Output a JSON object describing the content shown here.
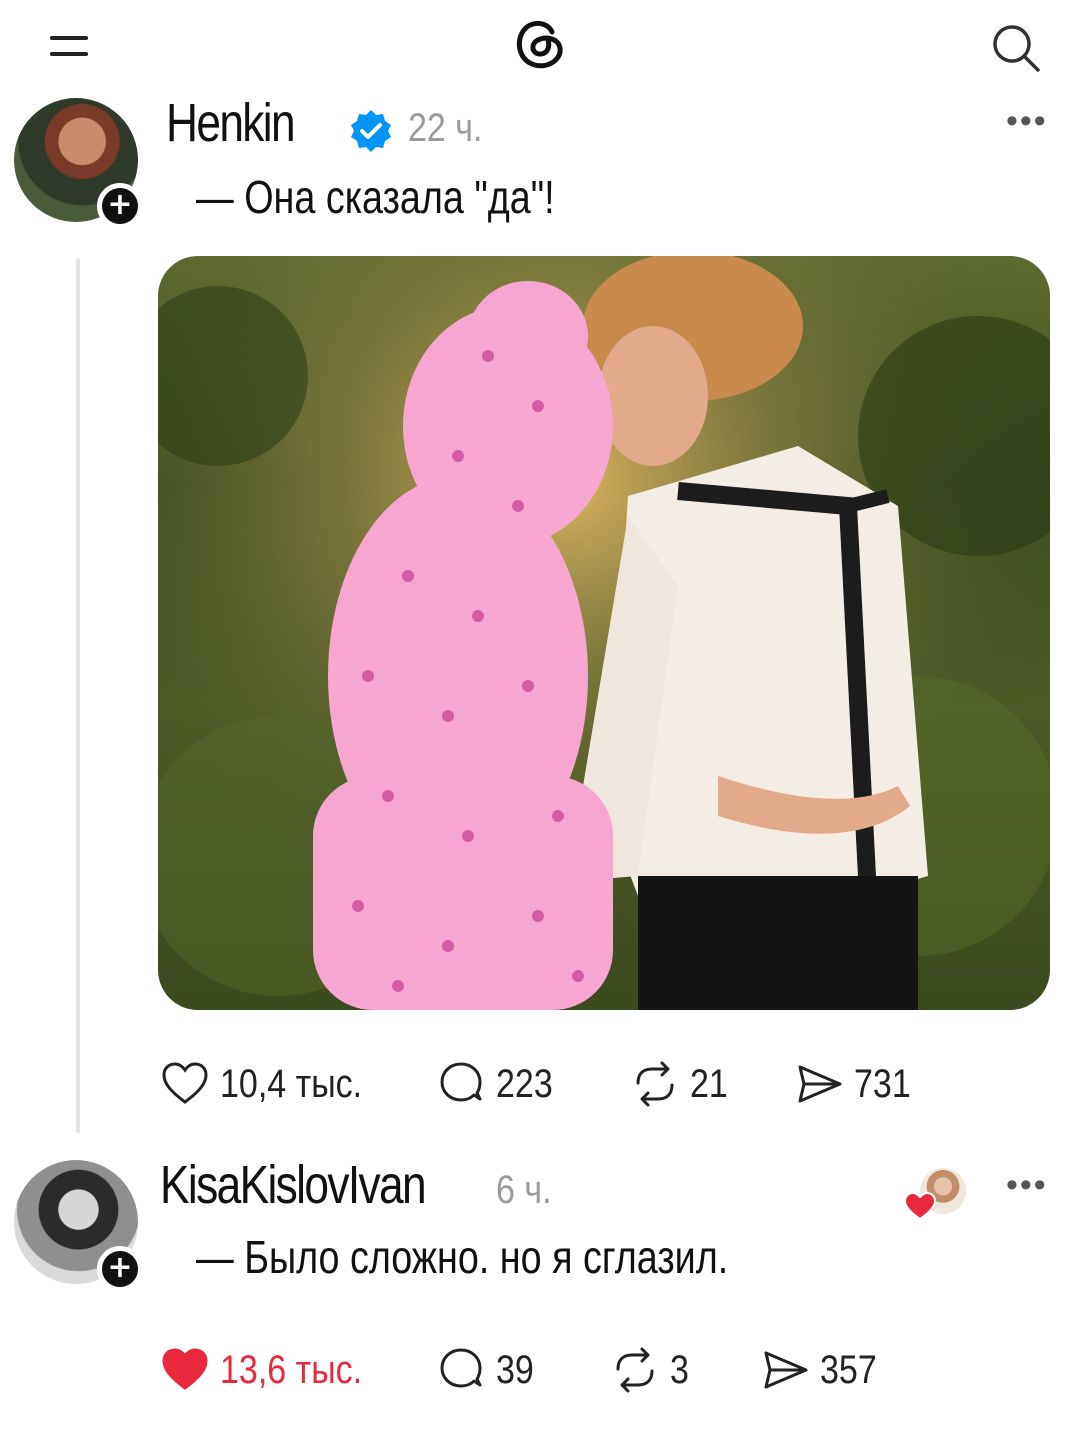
{
  "topbar": {
    "menu_icon": "menu-icon",
    "logo_icon": "threads-logo-icon",
    "search_icon": "search-icon"
  },
  "posts": [
    {
      "username": "Henkin",
      "verified": true,
      "time": "22 ч.",
      "text": "— Она сказала \"да\"!",
      "has_photo": true,
      "likes": "10,4 тыс.",
      "liked": false,
      "replies": "223",
      "reposts": "21",
      "shares": "731"
    },
    {
      "username": "KisaKislovIvan",
      "verified": false,
      "time": "6 ч.",
      "text": "— Было сложно. но я сглазил.",
      "has_photo": false,
      "likes": "13,6 тыс.",
      "liked": true,
      "replies": "39",
      "reposts": "3",
      "shares": "357"
    }
  ],
  "colors": {
    "like_active": "#e8293b",
    "verified": "#0095f6",
    "muted": "#9a9a9a"
  }
}
